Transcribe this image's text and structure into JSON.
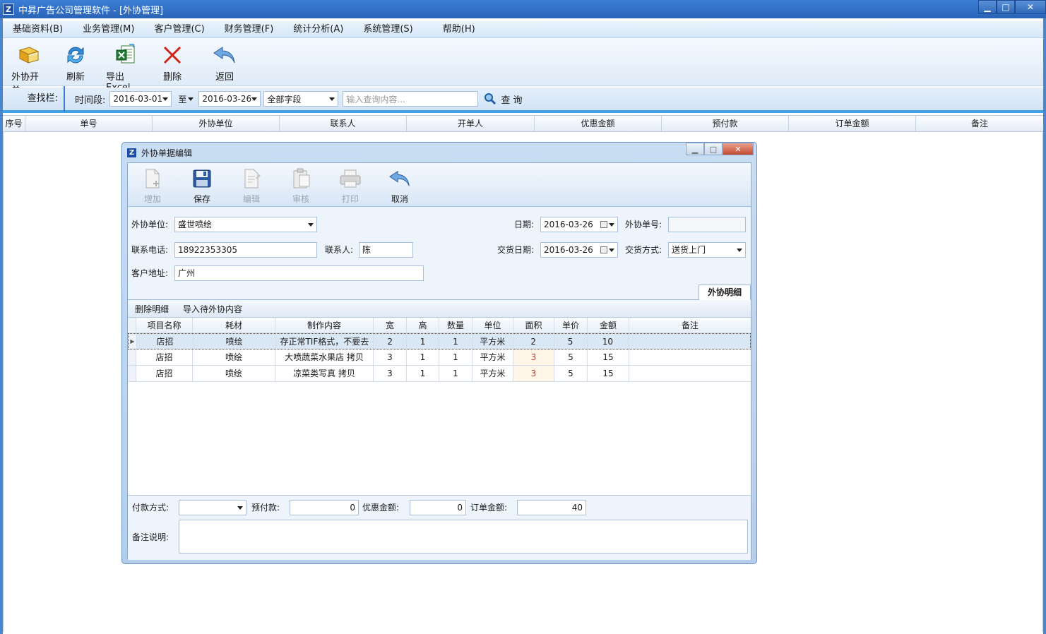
{
  "window": {
    "title": "中昇广告公司管理软件 - [外协管理]",
    "icon": "Z",
    "minimize": "▁",
    "maximize": "□",
    "close": "✕"
  },
  "menu": [
    {
      "label": "基础资料(B)"
    },
    {
      "label": "业务管理(M)"
    },
    {
      "label": "客户管理(C)"
    },
    {
      "label": "财务管理(F)"
    },
    {
      "label": "统计分析(A)"
    },
    {
      "label": "系统管理(S)"
    },
    {
      "label": "帮助(H)"
    }
  ],
  "toolbar": {
    "open_order": "外协开单",
    "refresh": "刷新",
    "export": "导出Excel",
    "delete": "删除",
    "back": "返回"
  },
  "search": {
    "label": "查找栏:",
    "period_label": "时间段:",
    "date_from": "2016-03-01",
    "to_label": "至",
    "date_to": "2016-03-26",
    "field": "全部字段",
    "placeholder": "输入查询内容...",
    "query_button": "查 询"
  },
  "main_grid": {
    "columns": [
      "序号",
      "单号",
      "外协单位",
      "联系人",
      "开单人",
      "优惠金额",
      "预付款",
      "订单金额",
      "备注"
    ]
  },
  "dialog": {
    "title": "外协单据编辑",
    "icon": "Z",
    "toolbar": {
      "add": "增加",
      "save": "保存",
      "edit": "编辑",
      "audit": "审核",
      "print": "打印",
      "cancel": "取消"
    },
    "form": {
      "vendor_label": "外协单位:",
      "vendor": "盛世喷绘",
      "date_label": "日期:",
      "date": "2016-03-26",
      "order_no_label": "外协单号:",
      "order_no": "",
      "phone_label": "联系电话:",
      "phone": "18922353305",
      "contact_label": "联系人:",
      "contact": "陈",
      "delivery_date_label": "交货日期:",
      "delivery_date": "2016-03-26",
      "delivery_method_label": "交货方式:",
      "delivery_method": "送货上门",
      "address_label": "客户地址:",
      "address": "广州"
    },
    "tab": "外协明细",
    "detail_toolbar": {
      "delete_detail": "删除明细",
      "import": "导入待外协内容"
    },
    "detail_columns": [
      "项目名称",
      "耗材",
      "制作内容",
      "宽",
      "高",
      "数量",
      "单位",
      "面积",
      "单价",
      "金额",
      "备注"
    ],
    "detail_rows": [
      {
        "name": "店招",
        "material": "喷绘",
        "content": "存正常TIF格式，不要去",
        "w": "2",
        "h": "1",
        "qty": "1",
        "unit": "平方米",
        "area": "2",
        "price": "5",
        "amount": "10",
        "note": ""
      },
      {
        "name": "店招",
        "material": "喷绘",
        "content": "大喷蔬菜水果店 拷贝",
        "w": "3",
        "h": "1",
        "qty": "1",
        "unit": "平方米",
        "area": "3",
        "price": "5",
        "amount": "15",
        "note": ""
      },
      {
        "name": "店招",
        "material": "喷绘",
        "content": "凉菜类写真 拷贝",
        "w": "3",
        "h": "1",
        "qty": "1",
        "unit": "平方米",
        "area": "3",
        "price": "5",
        "amount": "15",
        "note": ""
      }
    ],
    "footer": {
      "payment_label": "付款方式:",
      "payment": "",
      "prepay_label": "预付款:",
      "prepay": "0",
      "discount_label": "优惠金额:",
      "discount": "0",
      "total_label": "订单金额:",
      "total": "40",
      "remark_label": "备注说明:",
      "remark": ""
    }
  }
}
